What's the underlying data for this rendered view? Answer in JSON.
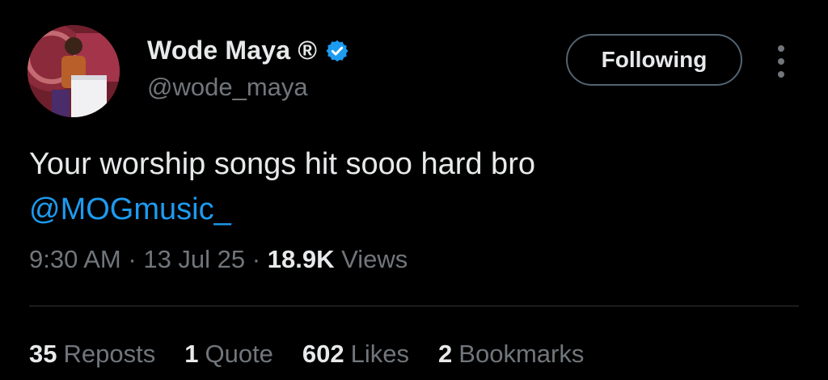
{
  "author": {
    "display_name": "Wode Maya ®",
    "handle": "@wode_maya",
    "verified_icon": "verified-badge-icon",
    "avatar": "profile-photo"
  },
  "follow_button": {
    "label": "Following"
  },
  "more_menu": {
    "icon": "more-vertical-icon"
  },
  "tweet": {
    "text": "Your worship songs hit sooo hard bro",
    "mention": "@MOGmusic_"
  },
  "meta": {
    "time": "9:30 AM",
    "separator": "·",
    "date": "13 Jul 25",
    "views_count": "18.9K",
    "views_label": "Views"
  },
  "stats": [
    {
      "count": "35",
      "label": "Reposts"
    },
    {
      "count": "1",
      "label": "Quote"
    },
    {
      "count": "602",
      "label": "Likes"
    },
    {
      "count": "2",
      "label": "Bookmarks"
    }
  ],
  "colors": {
    "background": "#000000",
    "primary_text": "#e7e9ea",
    "secondary_text": "#71767b",
    "accent": "#1d9bf0",
    "border": "#536471"
  }
}
